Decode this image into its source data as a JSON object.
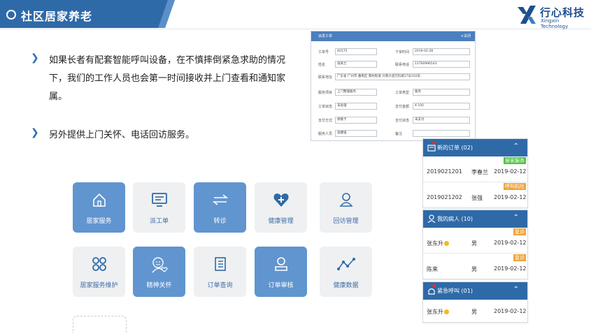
{
  "header": {
    "title": "社区居家养老"
  },
  "logo": {
    "name": "行心科技",
    "subtitle": "Xingxin Technology"
  },
  "bullets": [
    "如果长者有配套智能呼叫设备，在不慎摔倒紧急求助的情况下，我们的工作人员也会第一时间接收并上门查看和通知家属。",
    "另外提供上门关怀、电话回访服务。"
  ],
  "form": {
    "title": "派发工单",
    "close": "×关闭",
    "fields": [
      {
        "label": "工单号",
        "value": "A0175"
      },
      {
        "label": "下单时间",
        "value": "2019-02-28"
      },
      {
        "label": "姓名",
        "value": "张某兰"
      },
      {
        "label": "联系电话",
        "value": "13760996543"
      },
      {
        "label": "联系地址",
        "value": "广东省 广州市 番禺区 南村街道 兴南大道万科城17号102房"
      },
      {
        "label": "服务项目",
        "value": "上门整理服务"
      },
      {
        "label": "工单类型",
        "value": "服务"
      },
      {
        "label": "工单状态",
        "value": "未处理"
      },
      {
        "label": "支付金额",
        "value": "¥ 100"
      },
      {
        "label": "支付方式",
        "value": "余额卡"
      },
      {
        "label": "支付状态",
        "value": "未支付"
      },
      {
        "label": "服务人员",
        "value": "张健强"
      },
      {
        "label": "备注",
        "value": ""
      }
    ]
  },
  "panels": {
    "orders": {
      "title": "新的订单 (02)",
      "rows": [
        {
          "id": "2019021201",
          "name": "李春兰",
          "date": "2019-02-12",
          "tag": "居家服务"
        },
        {
          "id": "2019021202",
          "name": "张强",
          "date": "2019-02-12",
          "tag": "呼叫机吐"
        }
      ]
    },
    "patients": {
      "title": "我的病人 (10)",
      "rows": [
        {
          "name": "张东升",
          "gender": "男",
          "date": "2019-02-12",
          "tag": "复诊"
        },
        {
          "name": "陈来",
          "gender": "男",
          "date": "2019-02-12",
          "tag": "复诊"
        }
      ]
    },
    "emergency": {
      "title": "紧急呼叫 (01)",
      "rows": [
        {
          "name": "张东升",
          "gender": "男",
          "date": "2019-02-12"
        }
      ]
    }
  },
  "tiles": [
    {
      "label": "居家服务",
      "icon": "home-icon"
    },
    {
      "label": "派工单",
      "icon": "monitor-icon"
    },
    {
      "label": "转诊",
      "icon": "transfer-icon"
    },
    {
      "label": "健康管理",
      "icon": "heart-plus-icon"
    },
    {
      "label": "回访管理",
      "icon": "user-icon"
    },
    {
      "label": "居家服务维护",
      "icon": "grid-circles-icon"
    },
    {
      "label": "精神关怀",
      "icon": "person-heart-icon"
    },
    {
      "label": "订单查询",
      "icon": "list-doc-icon"
    },
    {
      "label": "订单审核",
      "icon": "user-check-icon"
    },
    {
      "label": "健康数据",
      "icon": "line-chart-icon"
    }
  ],
  "colors": {
    "accent": "#2f6aa8",
    "tile_blue": "#6195cf",
    "tile_grey": "#eef0f2",
    "tag_green": "#4cc73a",
    "tag_orange": "#f0a43a"
  }
}
